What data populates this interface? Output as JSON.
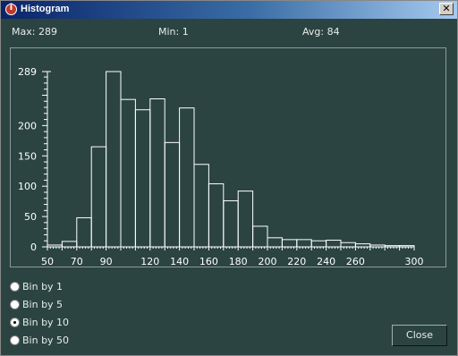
{
  "window": {
    "title": "Histogram",
    "close_glyph": "✕"
  },
  "stats": {
    "max": "Max: 289",
    "min": "Min: 1",
    "avg": "Avg: 84"
  },
  "chart_data": {
    "type": "bar",
    "bin_width": 10,
    "bins": [
      {
        "start": 50,
        "end": 60,
        "value": 3
      },
      {
        "start": 60,
        "end": 70,
        "value": 9
      },
      {
        "start": 70,
        "end": 80,
        "value": 48
      },
      {
        "start": 80,
        "end": 90,
        "value": 165
      },
      {
        "start": 90,
        "end": 100,
        "value": 289
      },
      {
        "start": 100,
        "end": 110,
        "value": 243
      },
      {
        "start": 110,
        "end": 120,
        "value": 226
      },
      {
        "start": 120,
        "end": 130,
        "value": 244
      },
      {
        "start": 130,
        "end": 140,
        "value": 172
      },
      {
        "start": 140,
        "end": 150,
        "value": 229
      },
      {
        "start": 150,
        "end": 160,
        "value": 136
      },
      {
        "start": 160,
        "end": 170,
        "value": 104
      },
      {
        "start": 170,
        "end": 180,
        "value": 76
      },
      {
        "start": 180,
        "end": 190,
        "value": 92
      },
      {
        "start": 190,
        "end": 200,
        "value": 34
      },
      {
        "start": 200,
        "end": 210,
        "value": 15
      },
      {
        "start": 210,
        "end": 220,
        "value": 12
      },
      {
        "start": 220,
        "end": 230,
        "value": 12
      },
      {
        "start": 230,
        "end": 240,
        "value": 10
      },
      {
        "start": 240,
        "end": 250,
        "value": 11
      },
      {
        "start": 250,
        "end": 260,
        "value": 7
      },
      {
        "start": 260,
        "end": 270,
        "value": 5
      },
      {
        "start": 270,
        "end": 280,
        "value": 3
      },
      {
        "start": 280,
        "end": 290,
        "value": 2
      },
      {
        "start": 290,
        "end": 300,
        "value": 2
      }
    ],
    "xlim": [
      50,
      300
    ],
    "ylim": [
      0,
      289
    ],
    "x_tick_labels": [
      50,
      70,
      90,
      120,
      140,
      160,
      180,
      200,
      220,
      240,
      260,
      300
    ],
    "y_tick_labels": [
      0,
      50,
      100,
      150,
      200,
      289
    ],
    "xlabel": "",
    "ylabel": "",
    "title": "",
    "grid": false,
    "colors": {
      "bar_stroke": "#ffffff",
      "background": "#2b4442"
    }
  },
  "bin_options": [
    {
      "label": "Bin by 1",
      "selected": false
    },
    {
      "label": "Bin by 5",
      "selected": false
    },
    {
      "label": "Bin by 10",
      "selected": true
    },
    {
      "label": "Bin by 50",
      "selected": false
    }
  ],
  "buttons": {
    "close": "Close"
  }
}
